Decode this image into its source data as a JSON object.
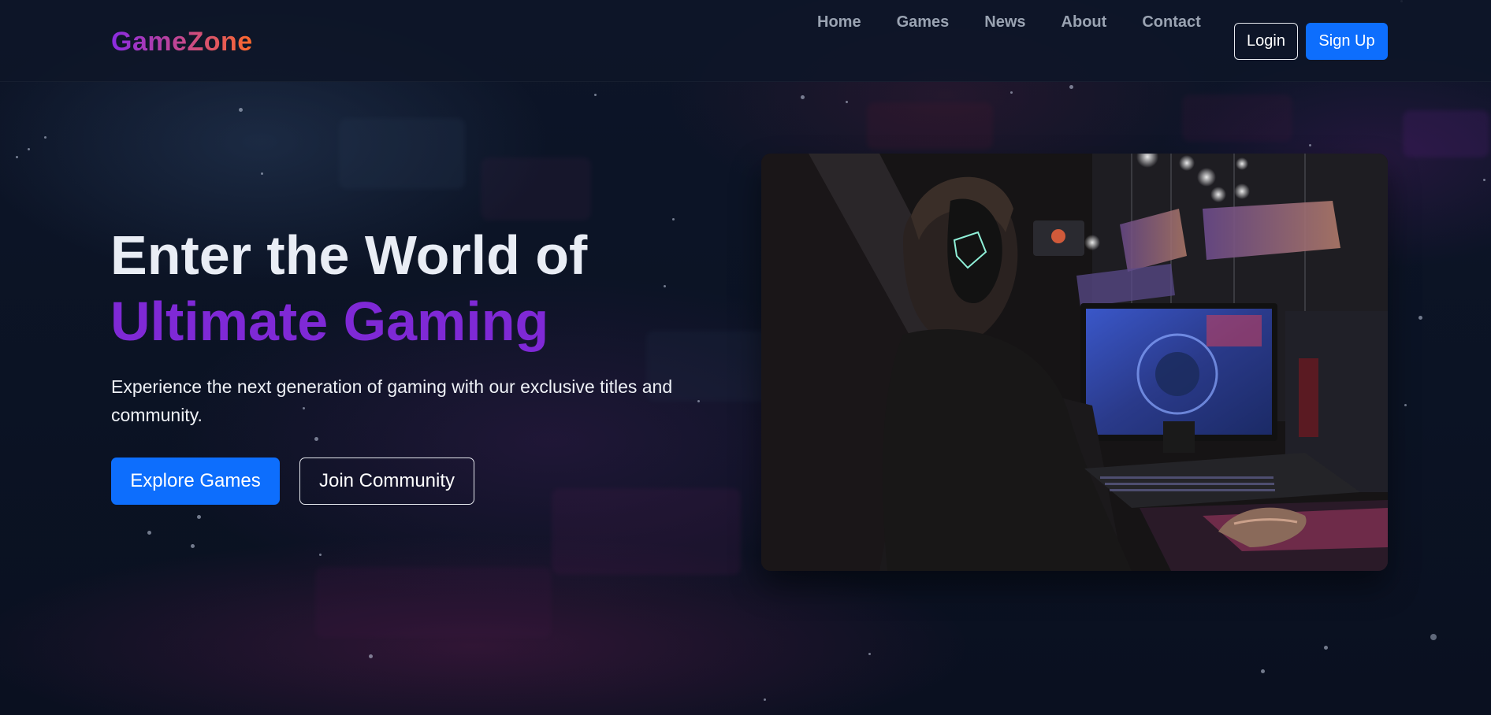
{
  "brand": {
    "name": "GameZone"
  },
  "nav": {
    "items": [
      "Home",
      "Games",
      "News",
      "About",
      "Contact"
    ],
    "login_label": "Login",
    "signup_label": "Sign Up"
  },
  "hero": {
    "title_line1": "Enter the World of",
    "title_line2": "Ultimate Gaming",
    "description": "Experience the next generation of gaming with our exclusive titles and community.",
    "primary_cta": "Explore Games",
    "secondary_cta": "Join Community",
    "image_icon": "gamer-photo-image"
  },
  "colors": {
    "background": "#0b1222",
    "primary": "#0d6efd",
    "accent_purple": "#7f29d6",
    "logo_gradient": [
      "#8a2be2",
      "#ff6a2a"
    ]
  }
}
